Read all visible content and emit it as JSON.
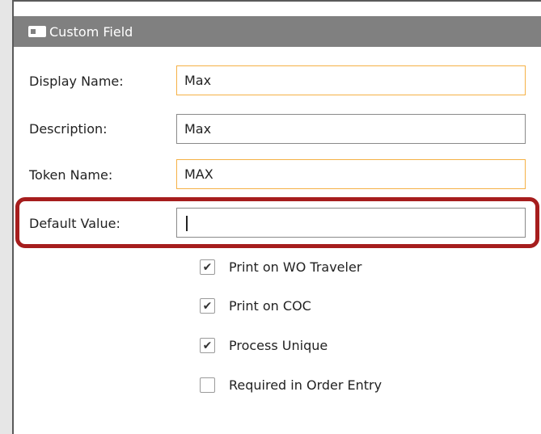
{
  "window": {
    "title": "Custom Field",
    "icon": "form-icon"
  },
  "fields": [
    {
      "label": "Display Name:",
      "value": "Max",
      "style": "required"
    },
    {
      "label": "Description:",
      "value": "Max",
      "style": "normal"
    },
    {
      "label": "Token Name:",
      "value": "MAX",
      "style": "required"
    },
    {
      "label": "Default Value:",
      "value": "",
      "style": "normal"
    }
  ],
  "options": [
    {
      "label": "Print on WO Traveler",
      "checked": true
    },
    {
      "label": "Print on COC",
      "checked": true
    },
    {
      "label": "Process Unique",
      "checked": true
    },
    {
      "label": "Required in Order Entry",
      "checked": false
    }
  ],
  "colors": {
    "highlight": "#a61d1d",
    "required_border": "#f5b146",
    "titlebar": "#808080"
  }
}
